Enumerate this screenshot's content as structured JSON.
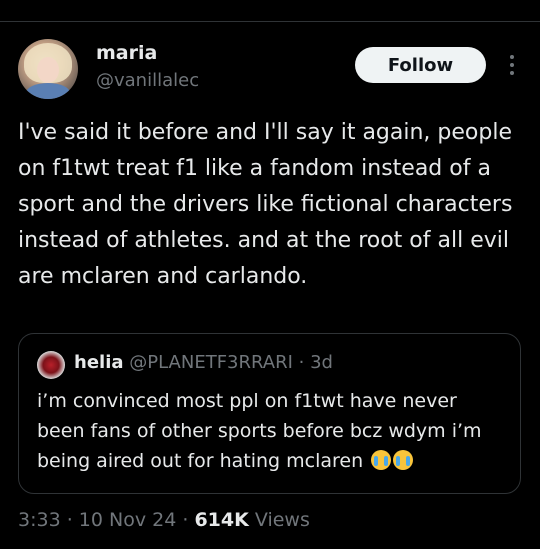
{
  "author": {
    "display_name": "maria",
    "handle": "@vanillalec"
  },
  "actions": {
    "follow_label": "Follow",
    "more_icon": "more-vertical-icon"
  },
  "tweet": {
    "text": "I've said it before and I'll say it again, people on f1twt treat f1 like a fandom instead of a sport and the drivers like fictional characters instead of athletes. and at the root of all evil are mclaren and carlando."
  },
  "quoted_tweet": {
    "display_name": "helia",
    "handle": "@PLANETF3RRARI",
    "separator": " · ",
    "age": "3d",
    "text": "i’m convinced most ppl on f1twt have never been fans of other sports before bcz wdym i’m being aired out for hating mclaren",
    "emojis": [
      "loudly-crying-face",
      "loudly-crying-face"
    ]
  },
  "meta": {
    "time": "3:33",
    "separator": " · ",
    "date": "10 Nov 24",
    "views_count": "614K",
    "views_label": " Views"
  },
  "colors": {
    "background": "#000000",
    "primary_text": "#e7e9ea",
    "secondary_text": "#71767b",
    "border": "#2f3336",
    "follow_button_bg": "#eff3f4"
  }
}
